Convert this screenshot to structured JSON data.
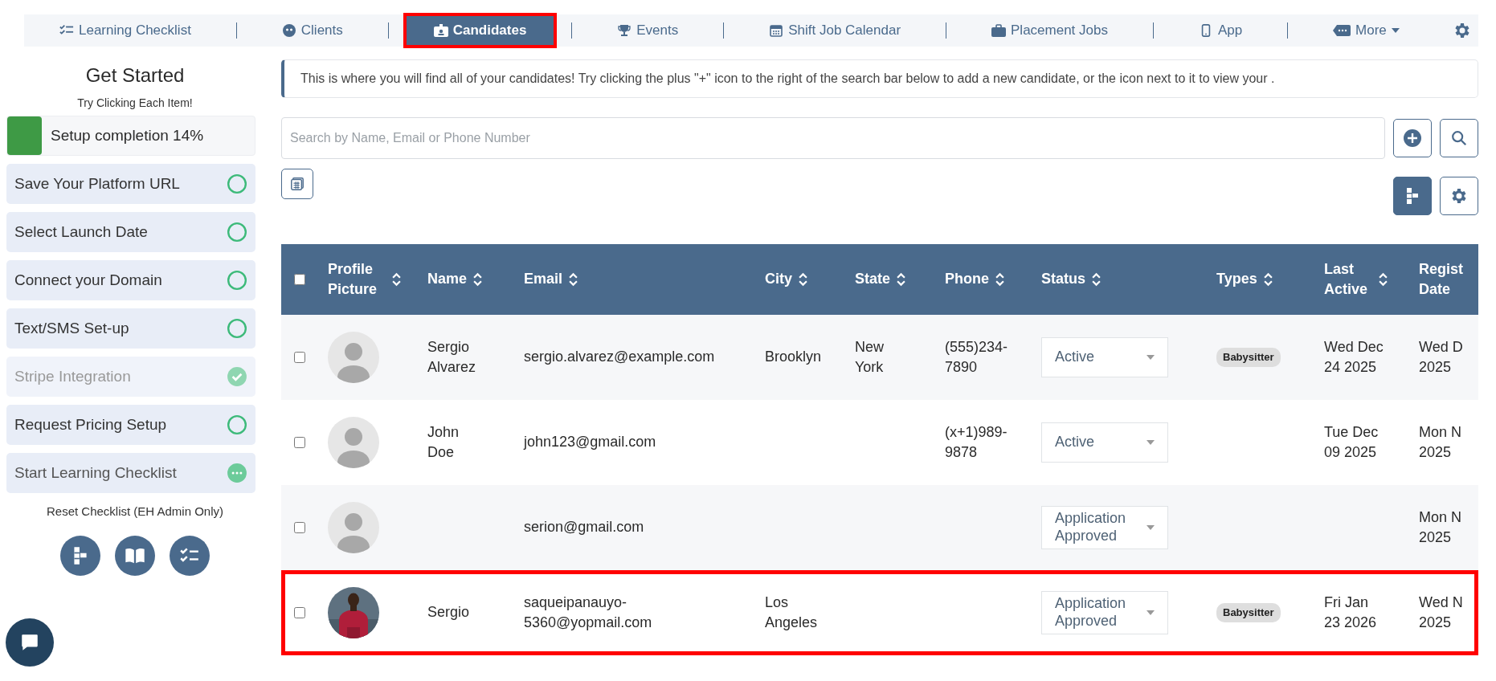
{
  "nav": {
    "tabs": [
      {
        "label": "Learning Checklist",
        "selected": false,
        "highlighted": false
      },
      {
        "label": "Clients",
        "selected": false,
        "highlighted": false
      },
      {
        "label": "Candidates",
        "selected": true,
        "highlighted": true
      },
      {
        "label": "Events",
        "selected": false,
        "highlighted": false
      },
      {
        "label": "Shift Job Calendar",
        "selected": false,
        "highlighted": false
      },
      {
        "label": "Placement Jobs",
        "selected": false,
        "highlighted": false
      },
      {
        "label": "App",
        "selected": false,
        "highlighted": false
      },
      {
        "label": "More",
        "selected": false,
        "highlighted": false
      }
    ]
  },
  "sidebar": {
    "title": "Get Started",
    "subtitle": "Try Clicking Each Item!",
    "progress": {
      "label": "Setup completion 14%",
      "level": 0.14
    },
    "items": [
      {
        "label": "Save Your Platform URL",
        "done": false,
        "started": false
      },
      {
        "label": "Select Launch Date",
        "done": false,
        "started": false
      },
      {
        "label": "Connect your Domain",
        "done": false,
        "started": false
      },
      {
        "label": "Text/SMS Set-up",
        "done": false,
        "started": false
      },
      {
        "label": "Stripe Integration",
        "done": true,
        "started": false
      },
      {
        "label": "Request Pricing Setup",
        "done": false,
        "started": false
      },
      {
        "label": "Start Learning Checklist",
        "done": false,
        "started": true
      }
    ],
    "reset_link": "Reset Checklist (EH Admin Only)"
  },
  "info_banner": "This is where you will find all of your candidates! Try clicking the plus \"+\" icon to the right of the search bar below to add a new candidate, or the icon next to it to view your .",
  "search": {
    "placeholder": "Search by Name, Email or Phone Number"
  },
  "table": {
    "select_all": {
      "checked": false
    },
    "columns": [
      {
        "label": "Profile Picture"
      },
      {
        "label": "Name"
      },
      {
        "label": "Email"
      },
      {
        "label": "City"
      },
      {
        "label": "State"
      },
      {
        "label": "Phone"
      },
      {
        "label": "Status"
      },
      {
        "label": "Types"
      },
      {
        "label": "Last Active"
      },
      {
        "label": "Regist Date"
      }
    ],
    "rows": [
      {
        "checked": false,
        "highlighted": false,
        "name": "Sergio Alvarez",
        "email": "sergio.alvarez@example.com",
        "city": "Brooklyn",
        "state": "New York",
        "phone": "(555)234-7890",
        "status": "Active",
        "types": [
          "Babysitter"
        ],
        "last_active": "Wed Dec 24 2025",
        "registration": "Wed D 2025"
      },
      {
        "checked": false,
        "highlighted": false,
        "name": "John Doe",
        "email": "john123@gmail.com",
        "phone": "(x+1)989-9878",
        "status": "Active",
        "last_active": "Tue Dec 09 2025",
        "registration": "Mon N 2025"
      },
      {
        "checked": false,
        "highlighted": false,
        "email": "serion@gmail.com",
        "status": "Application Approved",
        "registration": "Mon N 2025"
      },
      {
        "checked": false,
        "highlighted": true,
        "kind": "picture",
        "name": "Sergio",
        "email": "saqueipanauyo-5360@yopmail.com",
        "city": "Los Angeles",
        "status": "Application Approved",
        "types": [
          "Babysitter"
        ],
        "last_active": "Fri Jan 23 2026",
        "registration": "Wed N 2025"
      }
    ]
  }
}
